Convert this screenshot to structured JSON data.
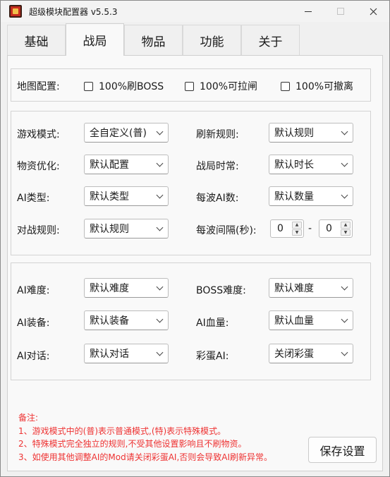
{
  "window": {
    "title": "超级模块配置器 v5.5.3"
  },
  "tabs": [
    {
      "label": "基础"
    },
    {
      "label": "战局"
    },
    {
      "label": "物品"
    },
    {
      "label": "功能"
    },
    {
      "label": "关于"
    }
  ],
  "map_config": {
    "label": "地图配置:",
    "options": [
      {
        "label": "100%刷BOSS",
        "checked": false
      },
      {
        "label": "100%可拉闸",
        "checked": false
      },
      {
        "label": "100%可撤离",
        "checked": false
      }
    ]
  },
  "game_settings": {
    "game_mode": {
      "label": "游戏模式:",
      "value": "全自定义(普)"
    },
    "refresh_rule": {
      "label": "刷新规则:",
      "value": "默认规则"
    },
    "supply_opt": {
      "label": "物资优化:",
      "value": "默认配置"
    },
    "match_duration": {
      "label": "战局时常:",
      "value": "默认时长"
    },
    "ai_type": {
      "label": "AI类型:",
      "value": "默认类型"
    },
    "ai_per_wave": {
      "label": "每波AI数:",
      "value": "默认数量"
    },
    "combat_rule": {
      "label": "对战规则:",
      "value": "默认规则"
    },
    "wave_interval": {
      "label": "每波间隔(秒):",
      "min": "0",
      "sep": "-",
      "max": "0"
    }
  },
  "ai_settings": {
    "ai_difficulty": {
      "label": "AI难度:",
      "value": "默认难度"
    },
    "boss_difficulty": {
      "label": "BOSS难度:",
      "value": "默认难度"
    },
    "ai_gear": {
      "label": "AI装备:",
      "value": "默认装备"
    },
    "ai_health": {
      "label": "AI血量:",
      "value": "默认血量"
    },
    "ai_dialog": {
      "label": "AI对话:",
      "value": "默认对话"
    },
    "easter_egg": {
      "label": "彩蛋AI:",
      "value": "关闭彩蛋"
    }
  },
  "notes": [
    "备注:",
    "1、游戏模式中的(普)表示普通模式,(特)表示特殊模式。",
    "2、特殊模式完全独立的规则,不受其他设置影响且不刷物资。",
    "3、如使用其他调整AI的Mod请关闭彩蛋AI,否则会导致AI刷新异常。"
  ],
  "save_button": {
    "label": "保存设置"
  },
  "colors": {
    "note_text": "#e33333",
    "accent_icon": "#c62c1e"
  }
}
